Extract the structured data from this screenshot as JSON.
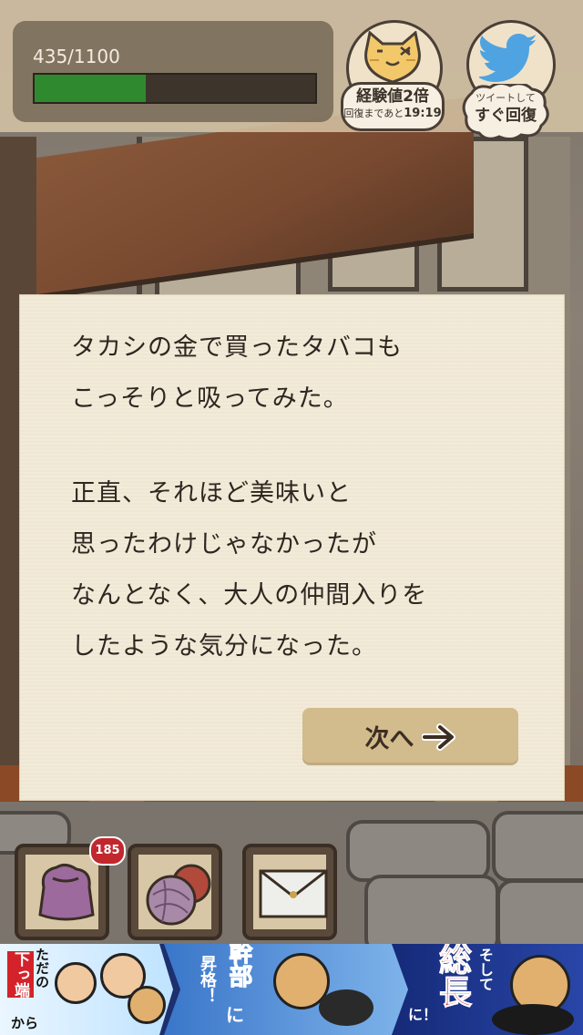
{
  "status": {
    "xp_text": "435/1100",
    "xp_current": 435,
    "xp_max": 1100,
    "xp_bar_color": "#2f8a2f"
  },
  "bonus": {
    "title": "経験値2倍",
    "countdown_label": "回復まであと",
    "countdown_time": "19:19",
    "icon": "cat-face-icon"
  },
  "tweet": {
    "label_small": "ツイートして",
    "label_big": "すぐ回復",
    "icon": "twitter-bird-icon",
    "accent": "#4fa3e0"
  },
  "dialog": {
    "lines": [
      "タカシの金で買ったタバコも",
      "こっそりと吸ってみた。",
      "",
      "正直、それほど美味いと",
      "思ったわけじゃなかったが",
      "なんとなく、大人の仲間入りを",
      "したような気分になった。"
    ],
    "next_label": "次へ",
    "next_icon": "arrow-right-icon"
  },
  "items": {
    "bag_badge": "185",
    "slots": [
      "bag-icon",
      "yarn-icon",
      "letter-icon"
    ]
  },
  "ad": {
    "seg1_a": "ただの",
    "seg1_b": "下っ端",
    "seg1_c": "から",
    "seg2_a": "幹部",
    "seg2_b": "に",
    "seg2_c": "昇格！",
    "seg3_a": "そして",
    "seg3_b": "総長",
    "seg3_c": "に！"
  }
}
